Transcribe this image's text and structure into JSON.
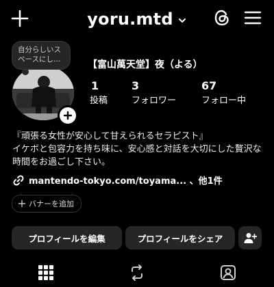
{
  "header": {
    "username": "yoru.mtd",
    "icons": [
      "plus-icon",
      "chevron-down-icon",
      "threads-icon",
      "hamburger-menu-icon"
    ]
  },
  "profile": {
    "note": "自分らしいスペースにし…",
    "display_name": "【富山萬天堂】夜（よる）",
    "stats": [
      {
        "value": "1",
        "label": "投稿"
      },
      {
        "value": "3",
        "label": "フォロワー"
      },
      {
        "value": "67",
        "label": "フォロー中"
      }
    ],
    "bio_line1": "『頑張る女性が安心して甘えられるセラピスト』",
    "bio_line2": "イケボと包容力を持ち味に、安心感と対話を大切にした贅沢な時間をお過ごし下さい。",
    "link": "mantendo-tokyo.com/toyama...  、他1件"
  },
  "actions": {
    "banner": "バナーを追加",
    "edit": "プロフィールを編集",
    "share": "プロフィールをシェア"
  },
  "tabs": [
    "grid-icon",
    "reels-repost-icon",
    "tagged-icon"
  ]
}
